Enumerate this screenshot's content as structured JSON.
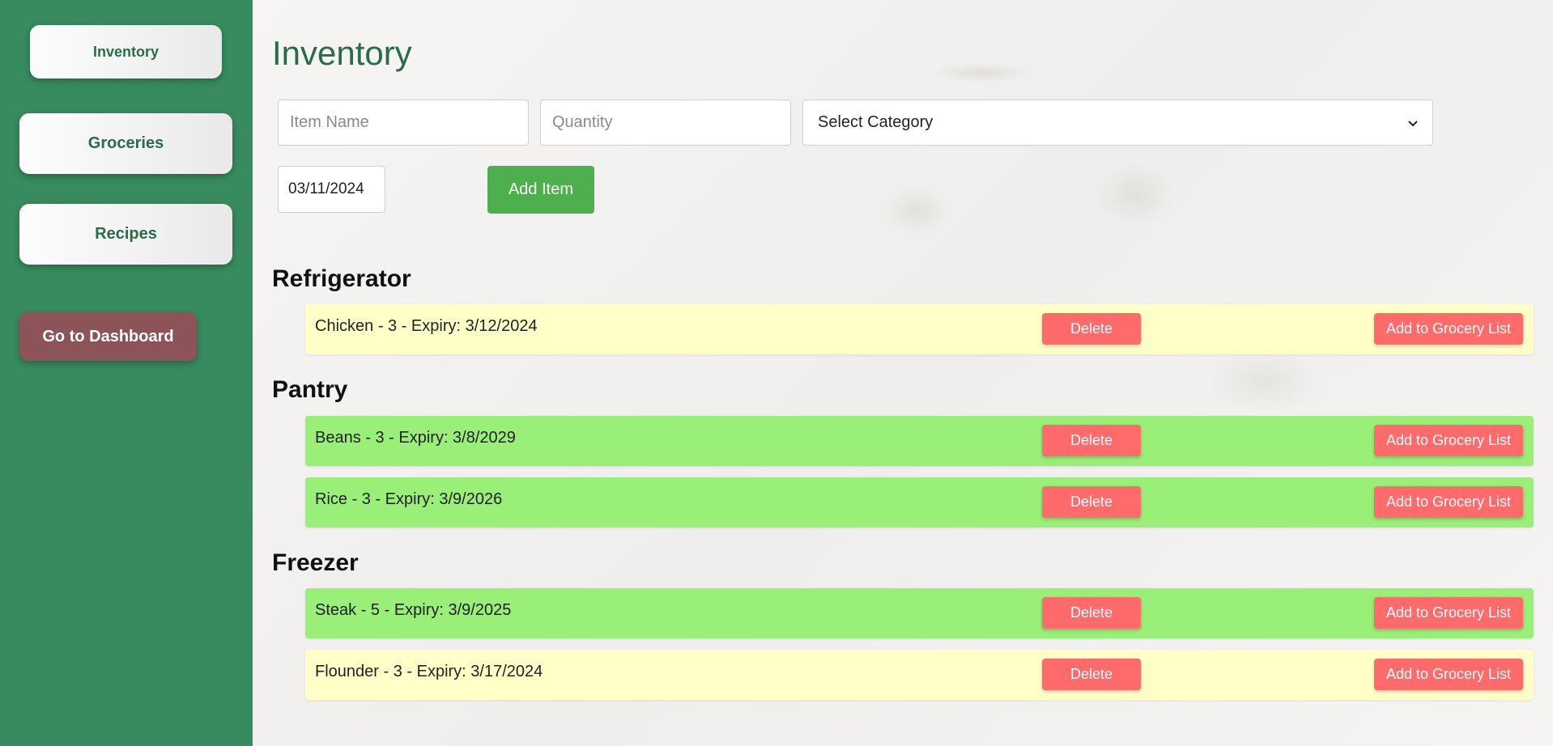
{
  "sidebar": {
    "inventory_label": "Inventory",
    "groceries_label": "Groceries",
    "recipes_label": "Recipes",
    "dashboard_label": "Go to Dashboard"
  },
  "main": {
    "title": "Inventory",
    "form": {
      "item_name_placeholder": "Item Name",
      "quantity_placeholder": "Quantity",
      "category_selected": "Select Category",
      "date_value": "03/11/2024",
      "add_label": "Add Item"
    },
    "sections": [
      {
        "title": "Refrigerator",
        "items": [
          {
            "text": "Chicken - 3 - Expiry: 3/12/2024",
            "status_color": "#ffffc8",
            "delete_label": "Delete",
            "grocery_label": "Add to Grocery List"
          }
        ]
      },
      {
        "title": "Pantry",
        "items": [
          {
            "text": "Beans - 3 - Expiry: 3/8/2029",
            "status_color": "#99ef77",
            "delete_label": "Delete",
            "grocery_label": "Add to Grocery List"
          },
          {
            "text": "Rice - 3 - Expiry: 3/9/2026",
            "status_color": "#99ef77",
            "delete_label": "Delete",
            "grocery_label": "Add to Grocery List"
          }
        ]
      },
      {
        "title": "Freezer",
        "items": [
          {
            "text": "Steak - 5 - Expiry: 3/9/2025",
            "status_color": "#99ef77",
            "delete_label": "Delete",
            "grocery_label": "Add to Grocery List"
          },
          {
            "text": "Flounder - 3 - Expiry: 3/17/2024",
            "status_color": "#ffffc8",
            "delete_label": "Delete",
            "grocery_label": "Add to Grocery List"
          }
        ]
      }
    ]
  },
  "colors": {
    "sidebar_bg": "#378b5e",
    "accent_green": "#2a6c4a",
    "add_button": "#4daf4e",
    "danger_button": "#ff6a6a",
    "dashboard_button": "#8c5458"
  }
}
